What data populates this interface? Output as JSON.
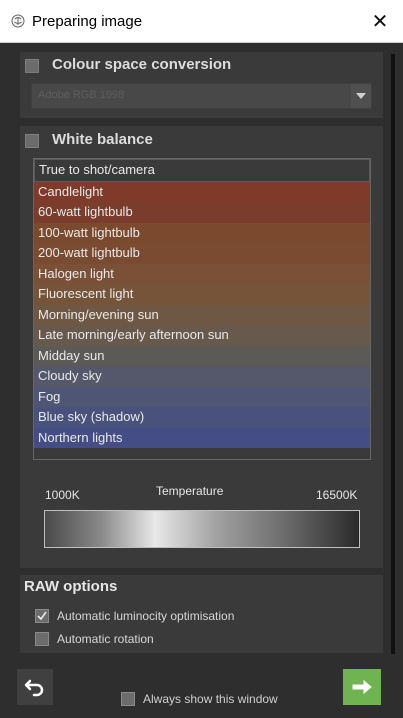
{
  "window": {
    "title": "Preparing image",
    "close_glyph": "✕",
    "app_icon": "brain-icon"
  },
  "colour_space": {
    "title": "Colour space conversion",
    "checked": false,
    "select_value": "Adobe RGB 1998",
    "dropdown_icon": "chevron-down-icon"
  },
  "white_balance": {
    "title": "White balance",
    "checked": false,
    "presets": [
      {
        "label": "True to shot/camera",
        "color": "#3a3a3a"
      },
      {
        "label": "Candlelight",
        "color": "#7f3a2a"
      },
      {
        "label": "60-watt lightbulb",
        "color": "#7a3d2b"
      },
      {
        "label": "100-watt lightbulb",
        "color": "#7b4a2e"
      },
      {
        "label": "200-watt lightbulb",
        "color": "#7a4b30"
      },
      {
        "label": "Halogen light",
        "color": "#7a5036"
      },
      {
        "label": "Fluorescent light",
        "color": "#76543a"
      },
      {
        "label": "Morning/evening sun",
        "color": "#6f5843"
      },
      {
        "label": "Late morning/early afternoon sun",
        "color": "#675a4d"
      },
      {
        "label": "Midday sun",
        "color": "#5b5a57"
      },
      {
        "label": "Cloudy sky",
        "color": "#55586a"
      },
      {
        "label": "Fog",
        "color": "#4f5674"
      },
      {
        "label": "Blue sky (shadow)",
        "color": "#49527c"
      },
      {
        "label": "Northern lights",
        "color": "#444d86"
      }
    ],
    "temperature": {
      "label": "Temperature",
      "min": "1000K",
      "max": "16500K"
    }
  },
  "raw_options": {
    "title": "RAW options",
    "items": [
      {
        "label": "Automatic luminocity optimisation",
        "checked": true
      },
      {
        "label": "Automatic rotation",
        "checked": false
      }
    ]
  },
  "footer": {
    "undo_icon": "undo-arrow-icon",
    "always_show_label": "Always show this window",
    "always_show_checked": false,
    "go_icon": "arrow-right-icon",
    "go_color": "#70b451"
  }
}
